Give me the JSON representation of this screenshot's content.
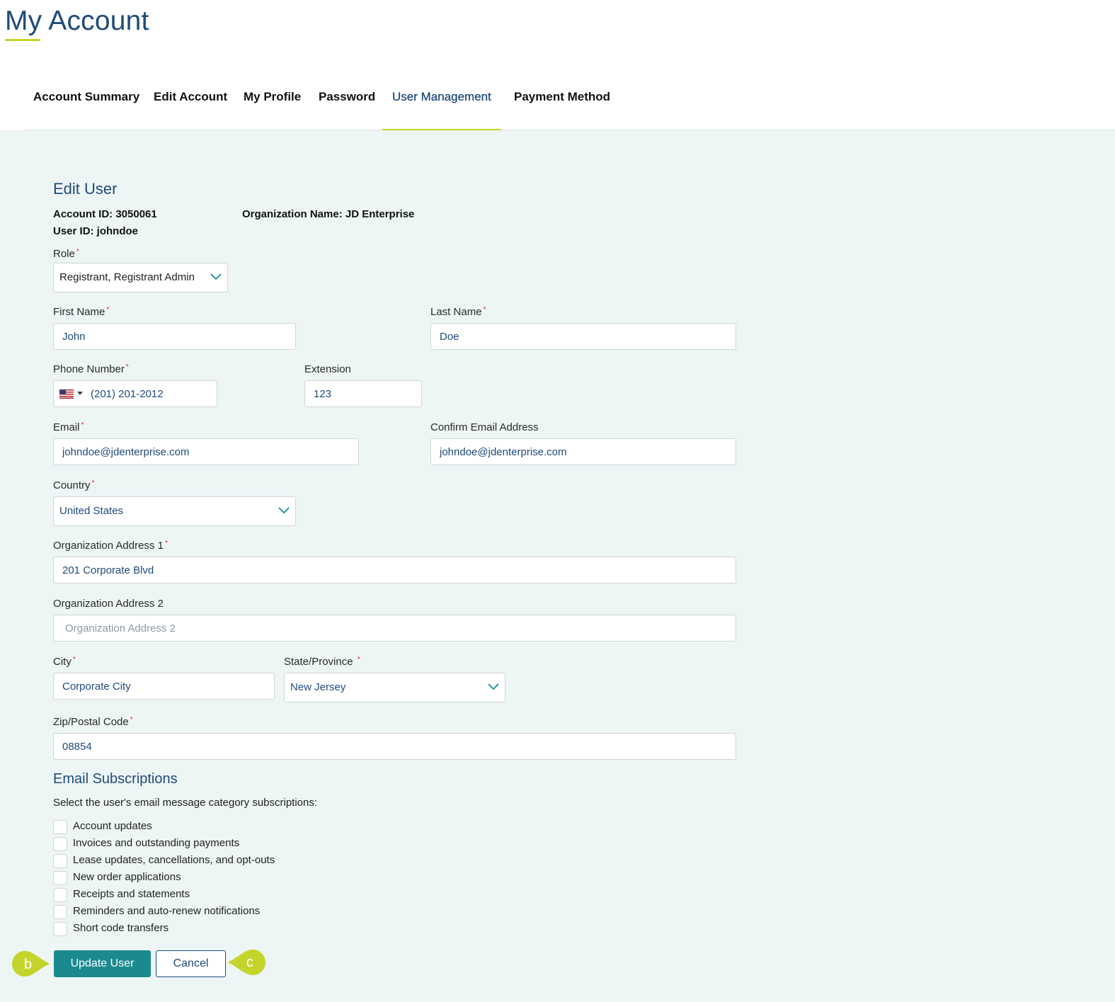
{
  "header": {
    "title": "My Account"
  },
  "tabs": [
    {
      "label": "Account Summary",
      "active": false
    },
    {
      "label": "Edit Account",
      "active": false
    },
    {
      "label": "My Profile",
      "active": false
    },
    {
      "label": "Password",
      "active": false
    },
    {
      "label": "User Management",
      "active": true
    },
    {
      "label": "Payment Method",
      "active": false
    }
  ],
  "form": {
    "heading": "Edit User",
    "account_id": "Account ID: 3050061",
    "user_id": "User ID: johndoe",
    "organization": "Organization Name: JD Enterprise",
    "role": {
      "label": "Role",
      "value": "Registrant, Registrant Admin"
    },
    "first_name": {
      "label": "First Name",
      "value": "John"
    },
    "last_name": {
      "label": "Last Name",
      "value": "Doe"
    },
    "phone": {
      "label": "Phone Number",
      "value": "(201) 201-2012",
      "country_flag": "us-flag-icon"
    },
    "extension": {
      "label": "Extension",
      "value": "123"
    },
    "email": {
      "label": "Email",
      "value": "johndoe@jdenterprise.com"
    },
    "confirm_email": {
      "label": "Confirm Email Address",
      "value": "johndoe@jdenterprise.com"
    },
    "country": {
      "label": "Country",
      "value": "United States"
    },
    "address1": {
      "label": "Organization Address 1",
      "value": "201 Corporate Blvd"
    },
    "address2": {
      "label": "Organization Address 2",
      "value": "",
      "placeholder": "Organization Address 2"
    },
    "city": {
      "label": "City",
      "value": "Corporate City"
    },
    "state": {
      "label": "State/Province",
      "value": "New Jersey"
    },
    "zip": {
      "label": "Zip/Postal Code",
      "value": "08854"
    },
    "required_mark": "*"
  },
  "subscriptions": {
    "heading": "Email Subscriptions",
    "description": "Select the user's email message category subscriptions:",
    "items": [
      {
        "label": "Account updates",
        "checked": false
      },
      {
        "label": "Invoices and outstanding payments",
        "checked": false
      },
      {
        "label": "Lease updates, cancellations, and opt-outs",
        "checked": false
      },
      {
        "label": "New order applications",
        "checked": false
      },
      {
        "label": "Receipts and statements",
        "checked": false
      },
      {
        "label": "Reminders and auto-renew notifications",
        "checked": false
      },
      {
        "label": "Short code transfers",
        "checked": false
      }
    ]
  },
  "actions": {
    "update_label": "Update User",
    "cancel_label": "Cancel"
  },
  "callouts": {
    "left": "b",
    "right": "c"
  },
  "colors": {
    "brand_blue": "#1f4b7a",
    "accent_lime": "#c5d42a",
    "teal_button": "#1a8a8f",
    "panel_bg": "#edf5f5"
  }
}
